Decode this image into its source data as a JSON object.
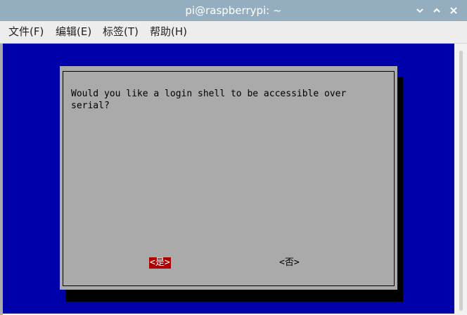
{
  "window": {
    "title": "pi@raspberrypi: ~",
    "controls": {
      "minimize": "⌄",
      "maximize": "⌃",
      "close": "✕"
    }
  },
  "menubar": {
    "items": [
      {
        "label": "文件(F)"
      },
      {
        "label": "编辑(E)"
      },
      {
        "label": "标签(T)"
      },
      {
        "label": "帮助(H)"
      }
    ]
  },
  "dialog": {
    "message": "Would you like a login shell to be accessible over\nserial?",
    "yes_label": "<是>",
    "no_label": "<否>"
  },
  "colors": {
    "terminal_bg": "#0000aa",
    "dialog_bg": "#aaaaaa",
    "focus_button_bg": "#aa0000",
    "titlebar_bg": "#94aebf"
  },
  "icons": [
    "chevron-down-icon",
    "chevron-up-icon",
    "close-icon"
  ]
}
